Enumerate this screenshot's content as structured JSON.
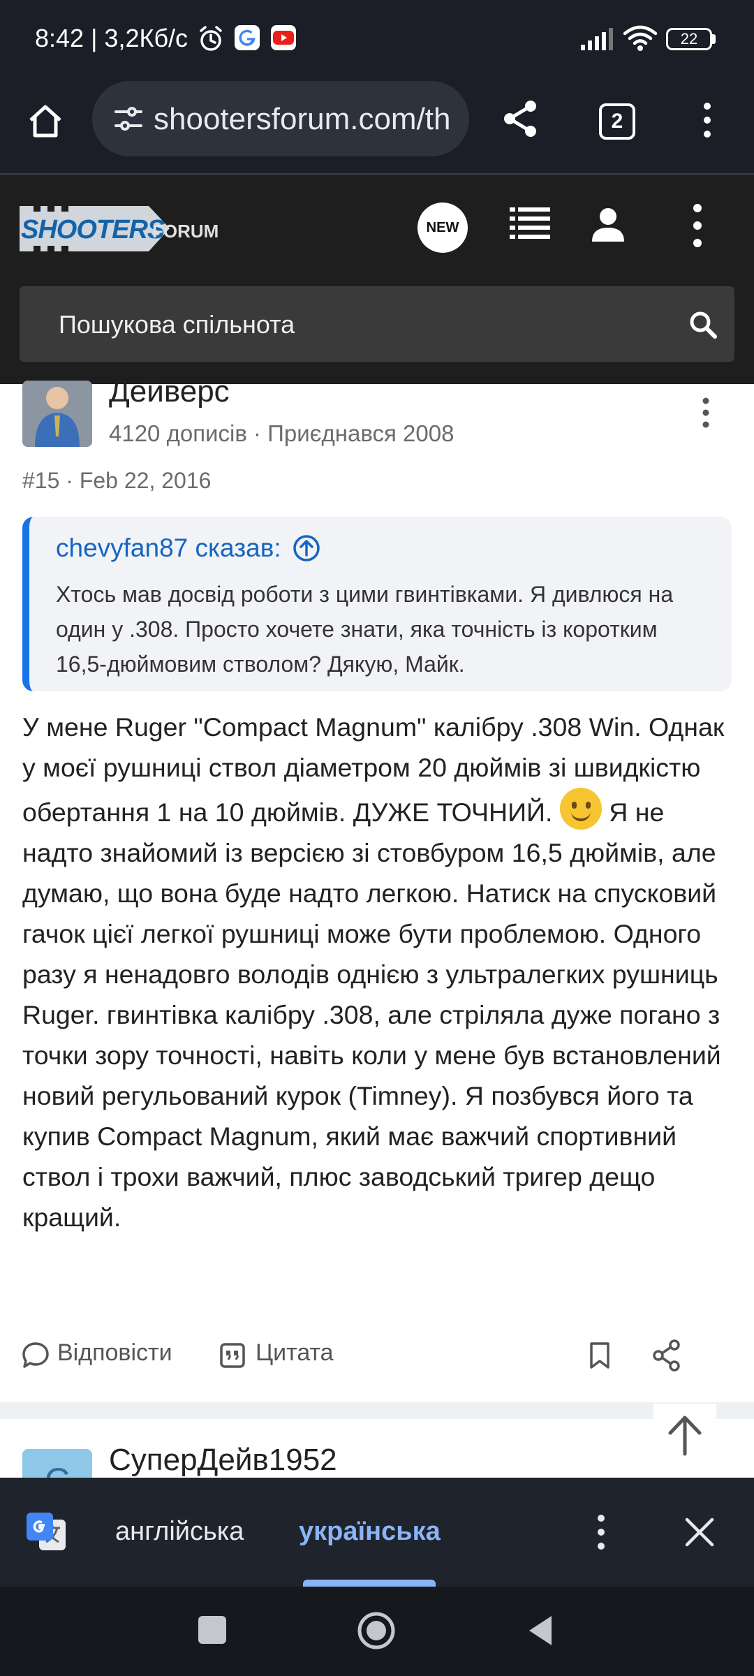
{
  "status_bar": {
    "time_speed": "8:42 | 3,2Кб/с",
    "battery": "22"
  },
  "browser": {
    "url": "shootersforum.com/th",
    "tab_count": "2"
  },
  "site": {
    "logo_main": "SHOOTERS",
    "logo_sub": "FORUM",
    "new_badge": "NEW",
    "search_placeholder": "Пошукова спільнота"
  },
  "post": {
    "author": "Дейверс",
    "meta": "4120 дописів · Приєднався 2008",
    "number_date": "#15 · Feb 22, 2016",
    "quote": {
      "author": "chevyfan87 сказав:",
      "text": "Хтось мав досвід роботи з цими гвинтівками. Я дивлюся на один у .308. Просто хочете знати, яка точність із коротким 16,5-дюймовим стволом? Дякую, Майк."
    },
    "body_part1": "У мене Ruger \"Compact Magnum\" калібру .308 Win. Однак у моєї рушниці ствол діаметром 20 дюймів зі швидкістю обертання 1 на 10 дюймів. ДУЖЕ ТОЧНИЙ.",
    "body_part2": "Я не надто знайомий із версією зі стовбуром 16,5 дюймів, але думаю, що вона буде надто легкою. Натиск на спусковий гачок цієї легкої рушниці може бути проблемою. Одного разу я ненадовго володів однією з ультралегких рушниць Ruger. гвинтівка калібру .308, але стріляла дуже погано з точки зору точності, навіть коли у мене був встановлений новий регульований курок (Timney). Я позбувся його та купив Compact Magnum, який має важчий спортивний ствол і трохи важчий, плюс заводський тригер дещо кращий.",
    "actions": {
      "reply": "Відповісти",
      "quote": "Цитата"
    }
  },
  "next_post": {
    "author": "СуперДейв1952",
    "avatar_letter": "С"
  },
  "translate_bar": {
    "source_lang": "англійська",
    "target_lang": "українська"
  }
}
